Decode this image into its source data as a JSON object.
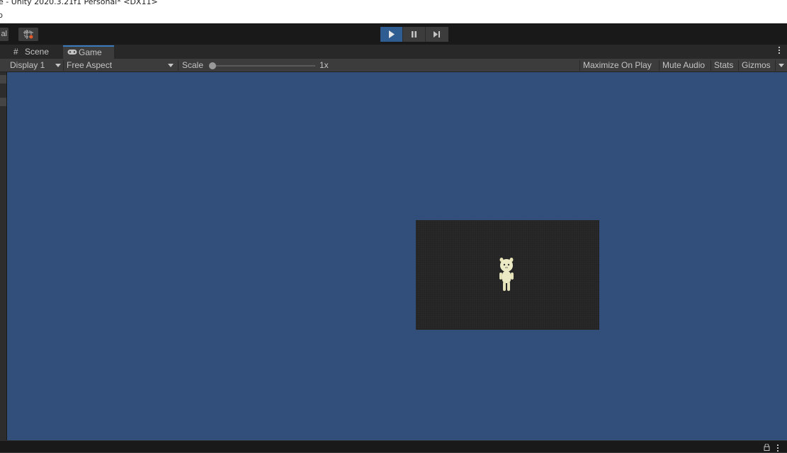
{
  "window": {
    "title": "e - Unity 2020.3.21f1 Personal* <DX11>",
    "menu_fragment": "p"
  },
  "toolbar": {
    "left_button_fragment": "al",
    "tool_icon": "rect-transform-icon",
    "play_controls": [
      {
        "name": "play",
        "icon": "play-icon",
        "active": true
      },
      {
        "name": "pause",
        "icon": "pause-icon",
        "active": false
      },
      {
        "name": "step",
        "icon": "step-icon",
        "active": false
      }
    ]
  },
  "tabs": [
    {
      "label": "Scene",
      "icon": "grid-icon",
      "active": false
    },
    {
      "label": "Game",
      "icon": "gamepad-icon",
      "active": true
    }
  ],
  "game_toolbar": {
    "display": "Display 1",
    "aspect": "Free Aspect",
    "scale_label": "Scale",
    "scale_value": "1x",
    "maximize": "Maximize On Play",
    "mute": "Mute Audio",
    "stats": "Stats",
    "gizmos": "Gizmos"
  },
  "colors": {
    "viewport_bg": "#324e7b",
    "game_bg": "#232323",
    "active_play": "#2f5d92",
    "tab_accent": "#3a79bb"
  }
}
